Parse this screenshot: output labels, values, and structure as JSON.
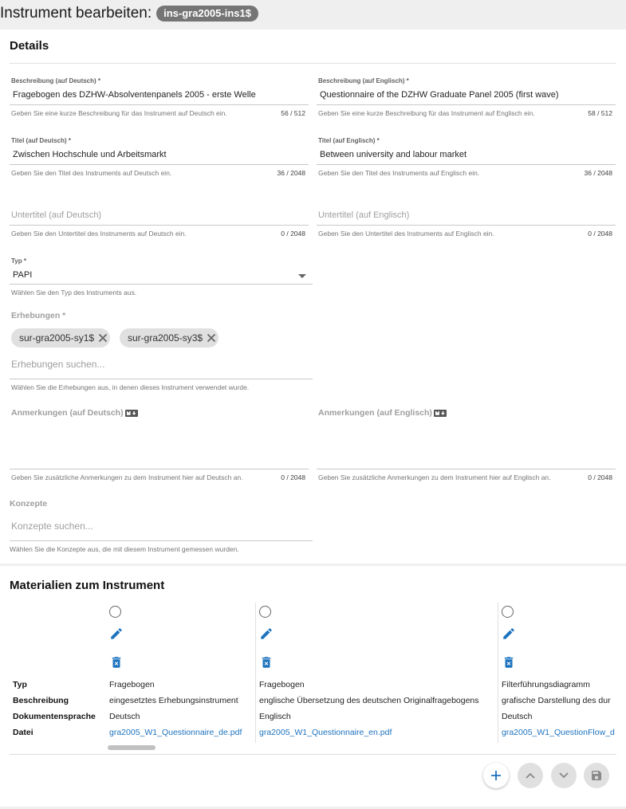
{
  "header": {
    "title": "Instrument bearbeiten:",
    "instrument_id": "ins-gra2005-ins1$"
  },
  "details": {
    "heading": "Details",
    "description_de": {
      "label": "Beschreibung (auf Deutsch) *",
      "value": "Fragebogen des DZHW-Absolventenpanels 2005 - erste Welle",
      "hint": "Geben Sie eine kurze Beschreibung für das Instrument auf Deutsch ein.",
      "count": "56 / 512"
    },
    "description_en": {
      "label": "Beschreibung (auf Englisch) *",
      "value": "Questionnaire of the DZHW Graduate Panel 2005 (first wave)",
      "hint": "Geben Sie eine kurze Beschreibung für das Instrument auf Englisch ein.",
      "count": "58 / 512"
    },
    "title_de": {
      "label": "Titel (auf Deutsch) *",
      "value": "Zwischen Hochschule und Arbeitsmarkt",
      "hint": "Geben Sie den Titel des Instruments auf Deutsch ein.",
      "count": "36 / 2048"
    },
    "title_en": {
      "label": "Titel (auf Englisch) *",
      "value": "Between university and labour market",
      "hint": "Geben Sie den Titel des Instruments auf Englisch ein.",
      "count": "36 / 2048"
    },
    "subtitle_de": {
      "placeholder": "Untertitel (auf Deutsch)",
      "hint": "Geben Sie den Untertitel des Instruments auf Deutsch ein.",
      "count": "0 / 2048"
    },
    "subtitle_en": {
      "placeholder": "Untertitel (auf Englisch)",
      "hint": "Geben Sie den Untertitel des Instruments auf Englisch ein.",
      "count": "0 / 2048"
    },
    "type": {
      "label": "Typ *",
      "value": "PAPI",
      "hint": "Wählen Sie den Typ des Instruments aus."
    },
    "surveys": {
      "label": "Erhebungen *",
      "chips": [
        "sur-gra2005-sy1$",
        "sur-gra2005-sy3$"
      ],
      "placeholder": "Erhebungen suchen...",
      "hint": "Wählen Sie die Erhebungen aus, in denen dieses Instrument verwendet wurde."
    },
    "annotations_de": {
      "label": "Anmerkungen (auf Deutsch)",
      "hint": "Geben Sie zusätzliche Anmerkungen zu dem Instrument hier auf Deutsch an.",
      "count": "0 / 2048"
    },
    "annotations_en": {
      "label": "Anmerkungen (auf Englisch)",
      "hint": "Geben Sie zusätzliche Anmerkungen zu dem Instrument hier auf Englisch an.",
      "count": "0 / 2048"
    },
    "concepts": {
      "label": "Konzepte",
      "placeholder": "Konzepte suchen...",
      "hint": "Wählen Sie die Konzepte aus, die mit diesem Instrument gemessen wurden."
    }
  },
  "materials": {
    "heading": "Materialien zum Instrument",
    "row_labels": [
      "Typ",
      "Beschreibung",
      "Dokumentensprache",
      "Datei"
    ],
    "columns": [
      {
        "type": "Fragebogen",
        "description": "eingesetztes Erhebungsinstrument",
        "language": "Deutsch",
        "file": "gra2005_W1_Questionnaire_de.pdf"
      },
      {
        "type": "Fragebogen",
        "description": "englische Übersetzung des deutschen Originalfragebogens",
        "language": "Englisch",
        "file": "gra2005_W1_Questionnaire_en.pdf"
      },
      {
        "type": "Filterführungsdiagramm",
        "description": "grafische Darstellung des dur",
        "language": "Deutsch",
        "file": "gra2005_W1_QuestionFlow_d"
      }
    ],
    "actions": [
      "add-icon",
      "move-up-icon",
      "move-down-icon",
      "save-icon"
    ]
  },
  "colors": {
    "accent": "#1e73be",
    "chip_bg": "#e0e0e0",
    "id_badge_bg": "#757575"
  }
}
